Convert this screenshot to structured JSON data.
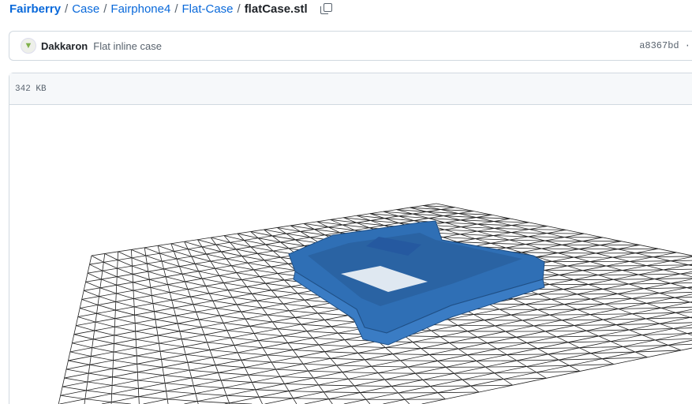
{
  "breadcrumb": {
    "items": [
      "Fairberry",
      "Case",
      "Fairphone4",
      "Flat-Case"
    ],
    "current": "flatCase.stl",
    "separator": "/"
  },
  "commit": {
    "author": "Dakkaron",
    "message": "Flat inline case",
    "sha": "a8367bd ·"
  },
  "file": {
    "size": "342  KB"
  },
  "colors": {
    "model": "#2f6fb5",
    "link": "#0969da"
  }
}
